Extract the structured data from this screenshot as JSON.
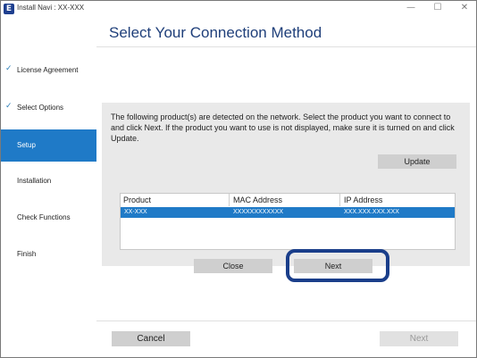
{
  "window": {
    "title": "Install Navi : XX-XXX",
    "app_icon_letter": "E",
    "controls": {
      "minimize": "—",
      "maximize": "☐",
      "close": "✕"
    }
  },
  "sidebar": {
    "items": [
      {
        "label": "License Agreement",
        "checked": true,
        "check_mark": "✓"
      },
      {
        "label": "Select Options",
        "checked": true,
        "check_mark": "✓"
      },
      {
        "label": "Setup",
        "active": true
      },
      {
        "label": "Installation"
      },
      {
        "label": "Check Functions"
      },
      {
        "label": "Finish"
      }
    ]
  },
  "main": {
    "heading": "Select Your Connection Method",
    "panel": {
      "message": "The following product(s) are detected on the network. Select the product you want to connect to and click Next. If the product you want to use is not displayed, make sure it is turned on and click Update.",
      "update_label": "Update",
      "table": {
        "columns": [
          "Product",
          "MAC Address",
          "IP Address"
        ],
        "rows": [
          {
            "product": "XX-XXX",
            "mac": "XXXXXXXXXXXX",
            "ip": "XXX.XXX.XXX.XXX",
            "selected": true
          }
        ]
      },
      "close_label": "Close",
      "next_label": "Next"
    }
  },
  "footer": {
    "cancel_label": "Cancel",
    "next_label": "Next"
  },
  "colors": {
    "accent": "#1f7ac7",
    "heading": "#1f3f7a",
    "highlight_ring": "#1a3e8a"
  }
}
